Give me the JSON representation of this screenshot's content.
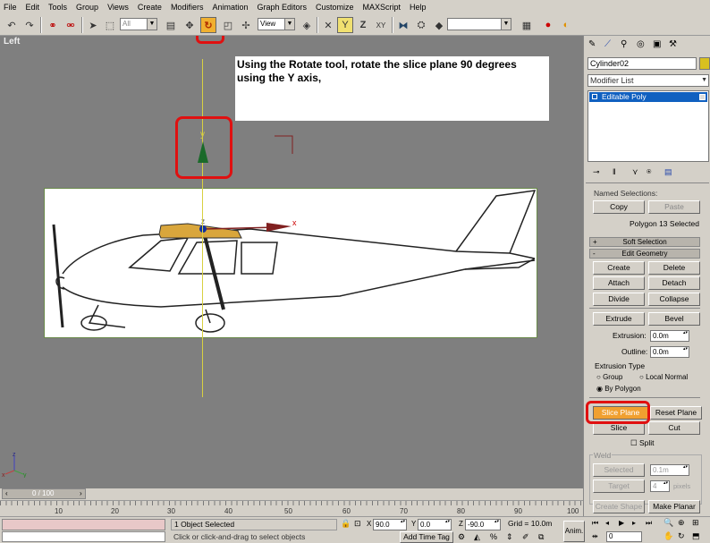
{
  "menu": [
    "File",
    "Edit",
    "Tools",
    "Group",
    "Views",
    "Create",
    "Modifiers",
    "Animation",
    "Graph Editors",
    "Customize",
    "MAXScript",
    "Help"
  ],
  "toolbar": {
    "selection_filter": "All",
    "ref_coord": "View",
    "named_selection": ""
  },
  "viewport": {
    "label": "Left",
    "instruction": "Using the Rotate tool, rotate the slice plane 90 degrees using the Y axis,",
    "gizmo_y_label": "y",
    "gizmo_x_label": "x",
    "gizmo_z_label": "z",
    "axis_triad_z": "z",
    "axis_triad_x": "x",
    "axis_triad_y": "y"
  },
  "command_panel": {
    "object_name": "Cylinder02",
    "modifier_list": "Modifier List",
    "stack_item": "Editable Poly",
    "named_selections_label": "Named Selections:",
    "copy_button": "Copy",
    "paste_button": "Paste",
    "selection_info": "Polygon 13 Selected",
    "soft_selection_sign": "+",
    "soft_selection": "Soft Selection",
    "edit_geometry_sign": "-",
    "edit_geometry": "Edit Geometry",
    "create_button": "Create",
    "delete_button": "Delete",
    "attach_button": "Attach",
    "detach_button": "Detach",
    "divide_button": "Divide",
    "collapse_button": "Collapse",
    "extrude_button": "Extrude",
    "bevel_button": "Bevel",
    "extrusion_label": "Extrusion:",
    "extrusion_value": "0.0m",
    "outline_label": "Outline:",
    "outline_value": "0.0m",
    "extrusion_type_label": "Extrusion Type",
    "group_option": "Group",
    "local_normal_option": "Local Normal",
    "by_polygon_option": "By Polygon",
    "slice_plane_button": "Slice Plane",
    "reset_plane_button": "Reset Plane",
    "slice_button": "Slice",
    "cut_button": "Cut",
    "split_label": "Split",
    "weld_label": "Weld",
    "selected_button": "Selected",
    "selected_value": "0.1m",
    "target_button": "Target",
    "target_value": "4",
    "pixels_label": "pixels",
    "create_shape_button": "Create Shape",
    "make_planar_button": "Make Planar"
  },
  "timeline": {
    "frame_counter": "0 / 100",
    "ticks": [
      "10",
      "20",
      "30",
      "40",
      "50",
      "60",
      "70",
      "80",
      "90",
      "100"
    ]
  },
  "status": {
    "selection_count": "1 Object Selected",
    "prompt": "Click or click-and-drag to select objects",
    "x_label": "X",
    "x_value": "90.0",
    "y_label": "Y",
    "y_value": "0.0",
    "z_label": "Z",
    "z_value": "-90.0",
    "grid": "Grid = 10.0m",
    "add_time_tag": "Add Time Tag",
    "anim_label": "Anim.",
    "frame_value": "0"
  },
  "colors": {
    "highlight": "#e01010",
    "slice_plane_active": "#f0a030",
    "viewport_bg": "#7f7f7f",
    "stack_selected": "#1060c0"
  }
}
